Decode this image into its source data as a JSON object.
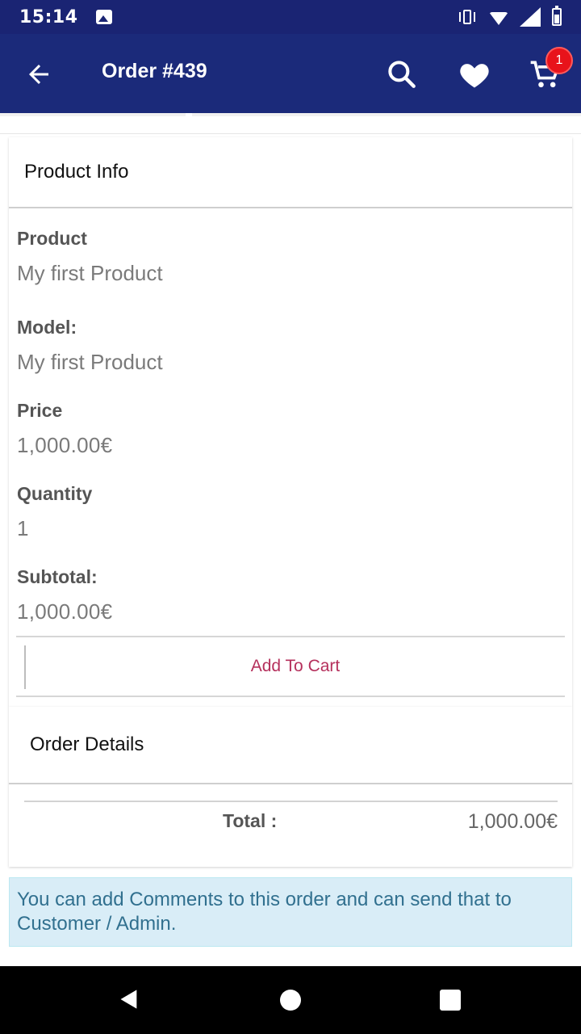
{
  "status_bar": {
    "time": "15:14",
    "icons": [
      "image-icon",
      "vibrate-icon",
      "wifi-icon",
      "signal-icon",
      "battery-icon"
    ]
  },
  "app_bar": {
    "title": "Order #439",
    "background": "#1b2a7a",
    "cart_badge_count": "1",
    "icons": [
      "back-arrow-icon",
      "search-icon",
      "heart-icon",
      "cart-icon"
    ]
  },
  "product_info": {
    "heading": "Product Info",
    "fields": [
      {
        "label": "Product",
        "value": "My first Product"
      },
      {
        "label": "Model:",
        "value": "My first Product"
      },
      {
        "label": "Price",
        "value": "1,000.00€"
      },
      {
        "label": "Quantity",
        "value": "1"
      },
      {
        "label": "Subtotal:",
        "value": "1,000.00€"
      }
    ],
    "add_to_cart_label": "Add To Cart",
    "add_to_cart_color": "#b5305c"
  },
  "order_details": {
    "heading": "Order Details",
    "total_label": "Total :",
    "total_value": "1,000.00€"
  },
  "comment_note": "You can add Comments to this order and can send that to Customer / Admin."
}
